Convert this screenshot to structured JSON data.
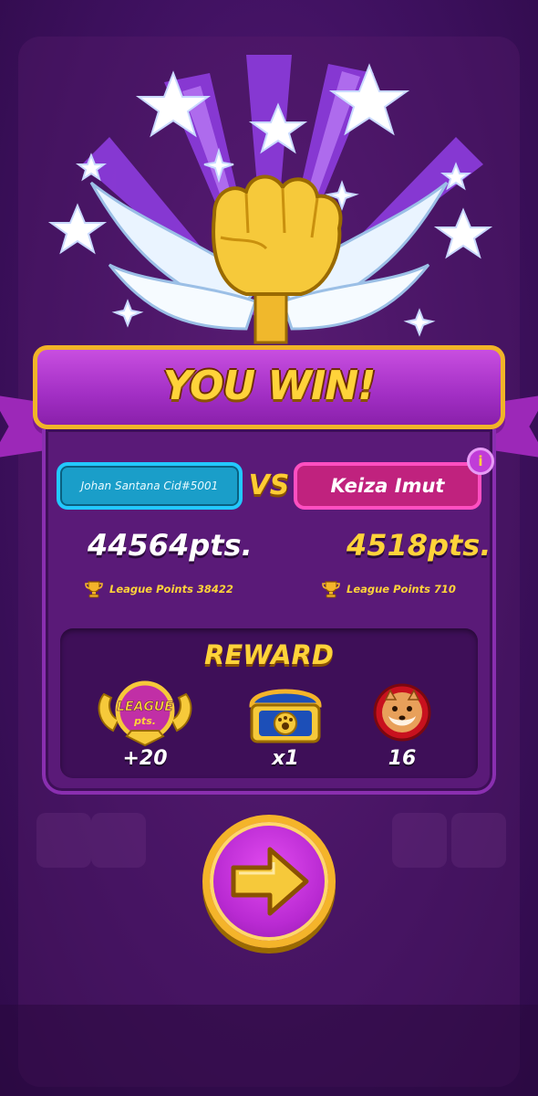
{
  "result": {
    "title": "YOU WIN!"
  },
  "players": {
    "left": {
      "name": "Johan Santana Cid#5001",
      "score": "44564pts.",
      "league_points_text": "League Points 38422"
    },
    "vs_label": "VS",
    "right": {
      "name": "Keiza Imut",
      "score": "4518pts.",
      "league_points_text": "League Points 710"
    }
  },
  "reward": {
    "title": "REWARD",
    "items": [
      {
        "icon": "league-pts-badge-icon",
        "badge_text_1": "LEAGUE",
        "badge_text_2": "pts.",
        "value": "+20"
      },
      {
        "icon": "treasure-chest-icon",
        "value": "x1"
      },
      {
        "icon": "shiba-token-icon",
        "value": "16"
      }
    ]
  },
  "colors": {
    "background": "#3f1160",
    "banner": "#a22fc4",
    "gold": "#ffd33a",
    "player_left": "#1a9ec9",
    "player_right": "#c0227e"
  }
}
